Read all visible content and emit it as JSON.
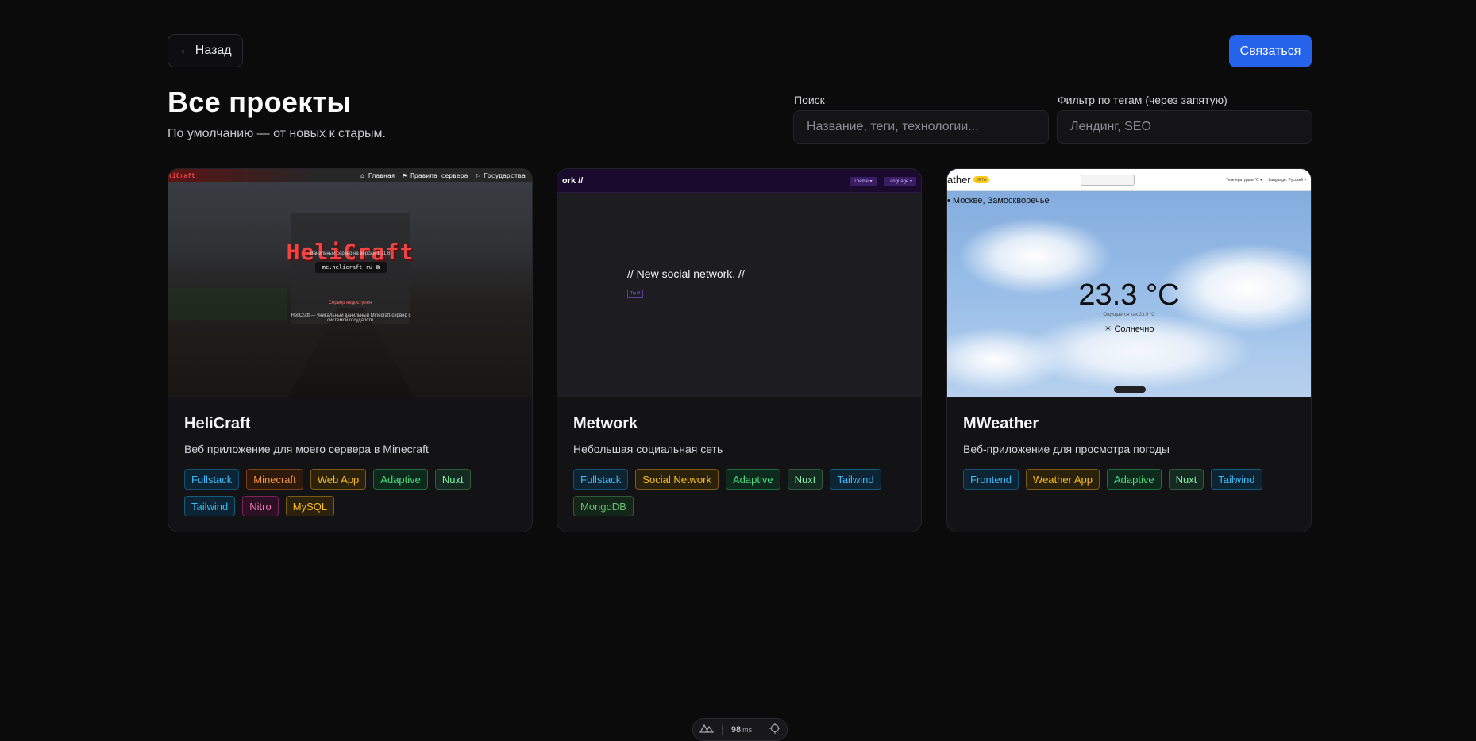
{
  "header": {
    "back_label": "← Назад",
    "contact_label": "Связаться",
    "title": "Все проекты",
    "subtitle": "По умолчанию — от новых к старым."
  },
  "search": {
    "label": "Поиск",
    "placeholder": "Название, теги, технологии..."
  },
  "filter": {
    "label": "Фильтр по тегам (через запятую)",
    "placeholder": "Лендинг, SEO"
  },
  "projects": [
    {
      "title": "HeliCraft",
      "description": "Веб приложение для моего сервера в Minecraft",
      "tags": [
        "Fullstack",
        "Minecraft",
        "Web App",
        "Adaptive",
        "Nuxt",
        "Tailwind",
        "Nitro",
        "MySQL"
      ],
      "preview": {
        "logo": "liCraft",
        "nav": [
          "⌂ Главная",
          "⚑ Правила сервера",
          "⚐ Государства"
        ],
        "heading": "HeliCraft",
        "version_text": "Ванильный сервер на версии 1.21.8",
        "ip": "mc.helicraft.ru  ⧉",
        "status": "Сервер недоступен",
        "about": "HeliCraft — уникальный ванильный Minecraft-сервер с системой государств."
      }
    },
    {
      "title": "Metwork",
      "description": "Небольшая социальная сеть",
      "tags": [
        "Fullstack",
        "Social Network",
        "Adaptive",
        "Nuxt",
        "Tailwind",
        "MongoDB"
      ],
      "preview": {
        "logo": "ork //",
        "theme": "Theme ▾",
        "language": "Language ▾",
        "headline": "// New social network. //",
        "button": "Try it!"
      }
    },
    {
      "title": "MWeather",
      "description": "Веб-приложение для просмотра погоды",
      "tags": [
        "Frontend",
        "Weather App",
        "Adaptive",
        "Nuxt",
        "Tailwind"
      ],
      "preview": {
        "logo": "ather",
        "badge": "BETA",
        "units": "Температура в °C ▾",
        "language": "Language: Русский ▾",
        "location": "• Москве, Замоскворечье",
        "temperature": "23.3 °C",
        "feels_like": "Ощущается как 23.9 °C",
        "condition": "☀ Солнечно"
      }
    }
  ],
  "devtools": {
    "time_value": "98",
    "time_unit": "ms"
  },
  "icons": {
    "nuxt": "nuxt-logo-icon",
    "target": "crosshair-icon"
  },
  "colors": {
    "accent": "#2563eb",
    "background": "#0b0b0c"
  }
}
